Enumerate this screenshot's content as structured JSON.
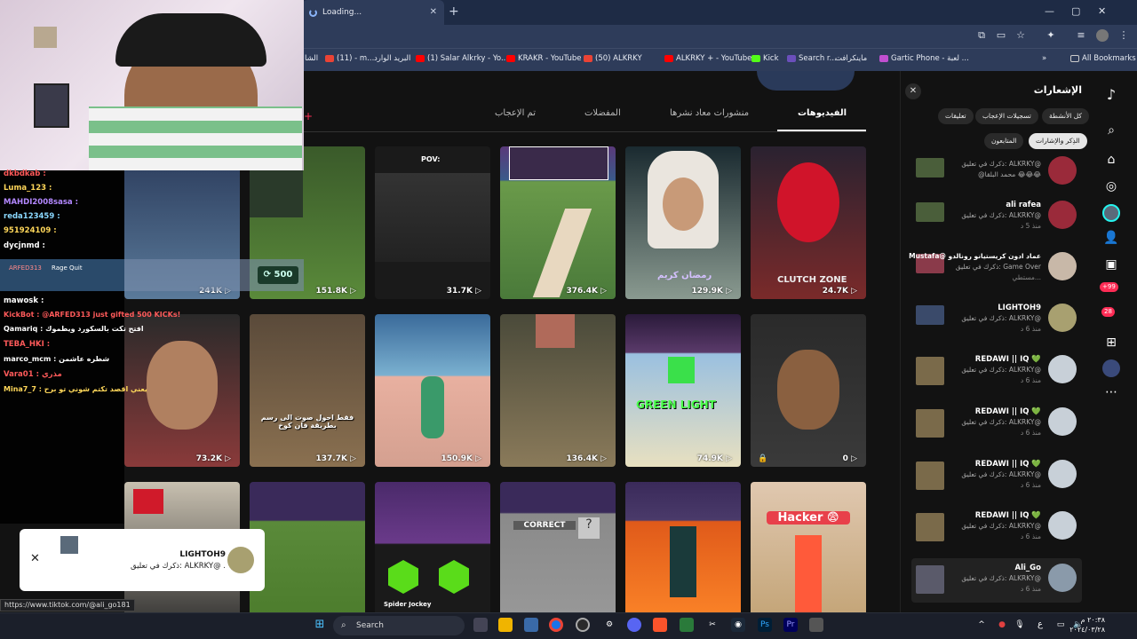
{
  "browser": {
    "tab_title": "Loading...",
    "tab_close": "✕",
    "new_tab": "+",
    "win_min": "—",
    "win_max": "▢",
    "win_close": "✕"
  },
  "bookmarks": {
    "items": [
      "الشا",
      "(11) - m...",
      "البريد الوارد",
      "(1) Salar Alkrky - Yo...",
      "KRAKR - YouTube",
      "(50) ALKRKY",
      "ALKRKY + - YouTube",
      "Kick",
      "Search r...",
      "ماينكرافت",
      "Gartic Phone - لعبة ...",
      "All Bookmarks"
    ],
    "more": "»"
  },
  "profile_tabs": {
    "videos": "الفيديوهات",
    "reposts": "منشورات معاد نشرها",
    "favorites": "المفضلات",
    "liked": "تم الإعجاب"
  },
  "videos": [
    {
      "views": "24.7K",
      "caption": "CLUTCH ZONE"
    },
    {
      "views": "129.9K",
      "caption": "رمضان كريم"
    },
    {
      "views": "376.4K",
      "caption": ""
    },
    {
      "views": "31.7K",
      "caption": "POV:"
    },
    {
      "views": "151.8K",
      "caption": ""
    },
    {
      "views": "241K",
      "caption": ""
    },
    {
      "views": "0",
      "caption": ""
    },
    {
      "views": "74.9K",
      "caption": "GREEN LIGHT"
    },
    {
      "views": "136.4K",
      "caption": ""
    },
    {
      "views": "150.9K",
      "caption": ""
    },
    {
      "views": "137.7K",
      "caption": "فقط احول صوت الى رسم بطريقة فان كوخ"
    },
    {
      "views": "73.2K",
      "caption": ""
    },
    {
      "views": "",
      "caption": "Hacker 😨"
    },
    {
      "views": "",
      "caption": ""
    },
    {
      "views": "",
      "caption": "CORRECT"
    },
    {
      "views": "",
      "caption": "Spider Jockey"
    },
    {
      "views": "",
      "caption": ""
    },
    {
      "views": "",
      "caption": ""
    }
  ],
  "notifications": {
    "title": "الإشعارات",
    "chips": [
      "كل الأنشطة",
      "تسجيلات الإعجاب",
      "تعليقات",
      "الذِكر والإشارات",
      "المتابعون"
    ],
    "items": [
      {
        "name": "",
        "text": "ذكرك في تعليق: ALKRKY@",
        "extra": "@محمد البلقا 😂😂😂",
        "time": ""
      },
      {
        "name": "ali rafea",
        "text": "ذكرك في تعليق: ALKRKY@",
        "extra": "",
        "time": "منذ 5 د"
      },
      {
        "name": "Mustafa@ عماد ادون كريستيانو رونالدو",
        "text": "ذكرك في تعليق: Game Over",
        "extra": "",
        "time": "مستطي..."
      },
      {
        "name": "LIGHTOH9",
        "text": "ذكرك في تعليق: ALKRKY@",
        "extra": "",
        "time": "منذ 6 د"
      },
      {
        "name": "REDAWI || IQ 💚",
        "text": "ذكرك في تعليق: ALKRKY@",
        "extra": "",
        "time": "منذ 6 د"
      },
      {
        "name": "REDAWI || IQ 💚",
        "text": "ذكرك في تعليق: ALKRKY@",
        "extra": "",
        "time": "منذ 6 د"
      },
      {
        "name": "REDAWI || IQ 💚",
        "text": "ذكرك في تعليق: ALKRKY@",
        "extra": "",
        "time": "منذ 6 د"
      },
      {
        "name": "REDAWI || IQ 💚",
        "text": "ذكرك في تعليق: ALKRKY@",
        "extra": "",
        "time": "منذ 6 د"
      },
      {
        "name": "Ali_Go",
        "text": "ذكرك في تعليق: ALKRKY@",
        "extra": "",
        "time": "منذ 6 د"
      }
    ]
  },
  "rail": {
    "badge1": "+99",
    "badge2": "28"
  },
  "chat": {
    "lines": [
      {
        "user": "dkbdkab :",
        "color": "#ff5a5a"
      },
      {
        "user": "Luma_123 :",
        "color": "#ffd75a"
      },
      {
        "user": "MAHDI2008sasa :",
        "color": "#b388ff"
      },
      {
        "user": "reda123459 :",
        "color": "#8ad8ff"
      },
      {
        "user": "951924109 :",
        "color": "#ffd75a"
      },
      {
        "user": "dycjnmd :",
        "color": "#ffffff"
      },
      {
        "user": "mawosk :",
        "color": "#ffffff"
      },
      {
        "user": "KickBot : @ARFED313 just gifted 500 KICKs!",
        "color": "#ff5a5a"
      },
      {
        "user": "Qamariq : افتح تكت بالسكورد ويطموك",
        "color": "#ffffff"
      },
      {
        "user": "TEBA_HKI :",
        "color": "#ff5a5a"
      },
      {
        "user": "marco_mcm : شطره عاشمن",
        "color": "#ffffff"
      },
      {
        "user": "Vara01 : مذري",
        "color": "#ff5a5a"
      },
      {
        "user": "Mina7_7 : يعني اقصد تكتم شوني تو برح",
        "color": "#ffd75a"
      }
    ],
    "gift_user": "ARFED313",
    "gift_label": "Rage Quit",
    "kicks": "500"
  },
  "popup": {
    "name": "LIGHTOH9",
    "text": "ذكرك في تعليق: ALKRKY@ .",
    "close": "✕"
  },
  "status_url": "https://www.tiktok.com/@ali_go181",
  "taskbar": {
    "search": "Search",
    "time": "٢٠:٣٨ م",
    "date": "٢٠٢٤/٠٣/٢٨",
    "lang": "ع"
  }
}
